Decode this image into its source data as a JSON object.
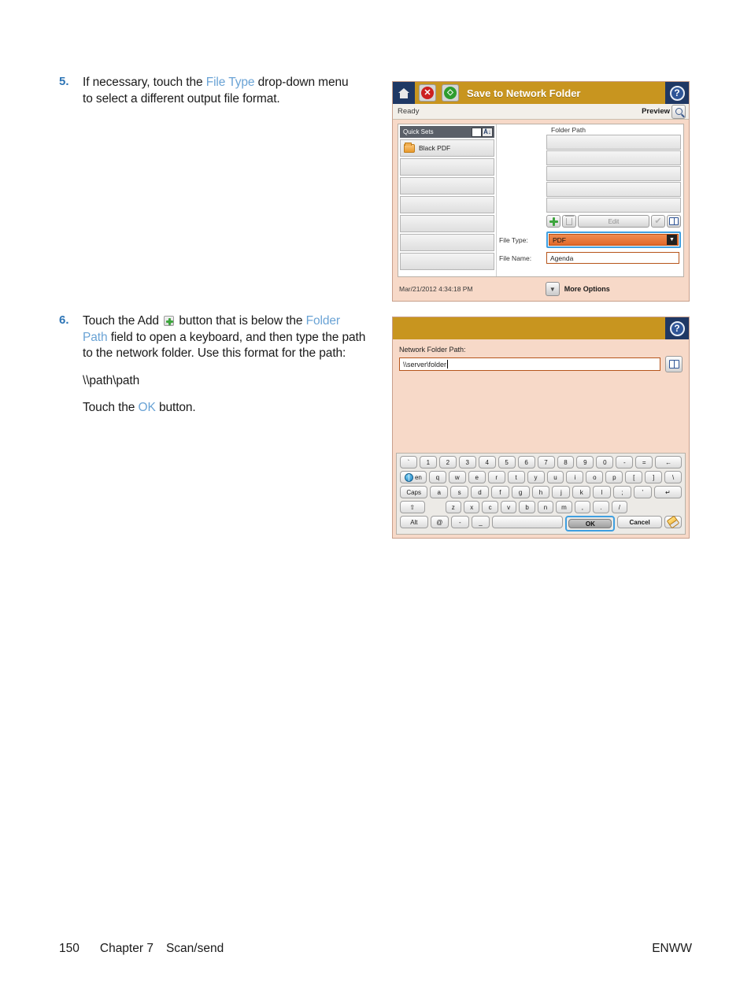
{
  "steps": [
    {
      "number": "5.",
      "text_before": "If necessary, touch the ",
      "link1": "File Type",
      "text_after": " drop-down menu to select a different output file format."
    },
    {
      "number": "6.",
      "part1": "Touch the Add ",
      "part2": " button that is below the ",
      "link1": "Folder Path",
      "part3": " field to open a keyboard, and then type the path to the network folder. Use this format for the path:",
      "path_example": "\\\\path\\path",
      "touch_before": "Touch the ",
      "link2": "OK",
      "touch_after": " button."
    }
  ],
  "screen1": {
    "header": {
      "title": "Save to Network Folder",
      "home_icon": "home-icon",
      "stop_icon": "stop-icon",
      "stop_glyph": "✕",
      "start_icon": "start-icon",
      "start_glyph": "◇",
      "help_icon": "help-icon",
      "help_glyph": "?"
    },
    "status": {
      "state": "Ready",
      "preview_label": "Preview",
      "preview_icon": "magnifier-icon"
    },
    "quick_sets": {
      "title": "Quick Sets",
      "sort_icon": "sort-az-icon",
      "sort_glyph": "Á↓",
      "items": [
        {
          "label": "Black PDF",
          "icon": "folder-icon"
        },
        {
          "label": "",
          "icon": ""
        },
        {
          "label": "",
          "icon": ""
        },
        {
          "label": "",
          "icon": ""
        },
        {
          "label": "",
          "icon": ""
        },
        {
          "label": "",
          "icon": ""
        },
        {
          "label": "",
          "icon": ""
        }
      ]
    },
    "folder_path": {
      "label": "Folder Path",
      "rows": [
        "",
        "",
        "",
        "",
        ""
      ],
      "toolbar": {
        "add_icon": "add-plus-icon",
        "delete_icon": "trash-icon",
        "edit_label": "Edit",
        "check_icon": "check-icon",
        "check_glyph": "✔",
        "book_icon": "address-book-icon"
      }
    },
    "file_type": {
      "label": "File Type:",
      "value": "PDF",
      "arrow_glyph": "▼",
      "focus_color": "#3f9fe0",
      "fill_color": "#e8763a"
    },
    "file_name": {
      "label": "File Name:",
      "value": "Agenda"
    },
    "footer": {
      "datetime": "Mar/21/2012 4:34:18 PM",
      "more_options_label": "More Options",
      "more_options_icon": "chevron-down-icon",
      "more_options_glyph": "▼"
    }
  },
  "screen2": {
    "header": {
      "title": "",
      "help_icon": "help-icon",
      "help_glyph": "?"
    },
    "field": {
      "label": "Network Folder Path:",
      "value": "\\\\server\\folder",
      "book_icon": "address-book-icon"
    },
    "keyboard": {
      "rows": [
        [
          "`",
          "1",
          "2",
          "3",
          "4",
          "5",
          "6",
          "7",
          "8",
          "9",
          "0",
          "-",
          "=",
          "←"
        ],
        [
          "en",
          "q",
          "w",
          "e",
          "r",
          "t",
          "y",
          "u",
          "i",
          "o",
          "p",
          "[",
          "]",
          "\\"
        ],
        [
          "Caps",
          "a",
          "s",
          "d",
          "f",
          "g",
          "h",
          "j",
          "k",
          "l",
          ";",
          "'",
          "↵"
        ],
        [
          "⇧",
          "z",
          "x",
          "c",
          "v",
          "b",
          "n",
          "m",
          ",",
          ".",
          "/"
        ],
        [
          "Alt",
          "@",
          "-",
          "_",
          "",
          "OK",
          "Cancel",
          ""
        ]
      ],
      "globe_icon": "globe-language-icon",
      "backspace_icon": "backspace-icon",
      "enter_icon": "enter-icon",
      "shift_icon": "shift-icon",
      "eraser_icon": "eraser-clear-icon",
      "ok_label": "OK",
      "cancel_label": "Cancel",
      "ok_focused": true
    }
  },
  "page_footer": {
    "page_number": "150",
    "chapter": "Chapter 7",
    "section": "Scan/send",
    "right": "ENWW"
  }
}
